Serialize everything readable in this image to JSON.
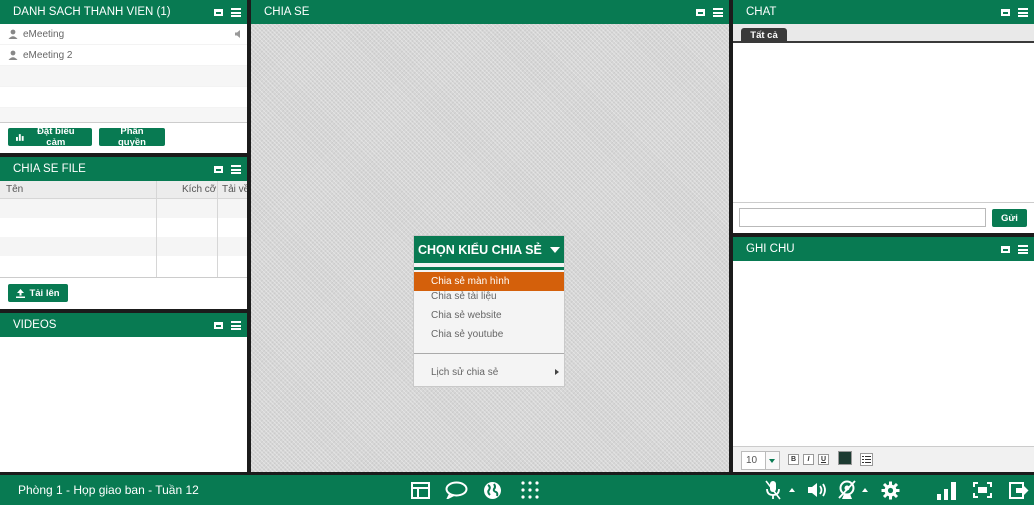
{
  "members": {
    "title": "DANH SÁCH THÀNH VIÊN (1)",
    "users": [
      "eMeeting",
      "eMeeting 2"
    ],
    "btn_emote": "Đặt biểu cảm",
    "btn_perm": "Phân quyền"
  },
  "files": {
    "title": "CHIA SẺ FILE",
    "columns": [
      "Tên",
      "Kích cỡ",
      "Tải về"
    ],
    "upload": "Tải lên"
  },
  "videos": {
    "title": "VIDEOS"
  },
  "share": {
    "title": "CHIA SẺ",
    "menu_title": "CHỌN KIỂU CHIA SẺ",
    "items": [
      "Chia sẻ màn hình",
      "Chia sẻ tài liệu",
      "Chia sẻ website",
      "Chia sẻ youtube"
    ],
    "history": "Lịch sử chia sẻ"
  },
  "chat": {
    "title": "CHAT",
    "tab": "Tất cả",
    "input": "",
    "send": "Gửi"
  },
  "notes": {
    "title": "GHI CHÚ",
    "font_size": "10",
    "bold": "B",
    "italic": "I",
    "underline": "U"
  },
  "bottom": {
    "room": "Phòng 1 - Họp giao ban - Tuần 12"
  },
  "colors": {
    "primary": "#087a52",
    "selected": "#d4600b"
  }
}
